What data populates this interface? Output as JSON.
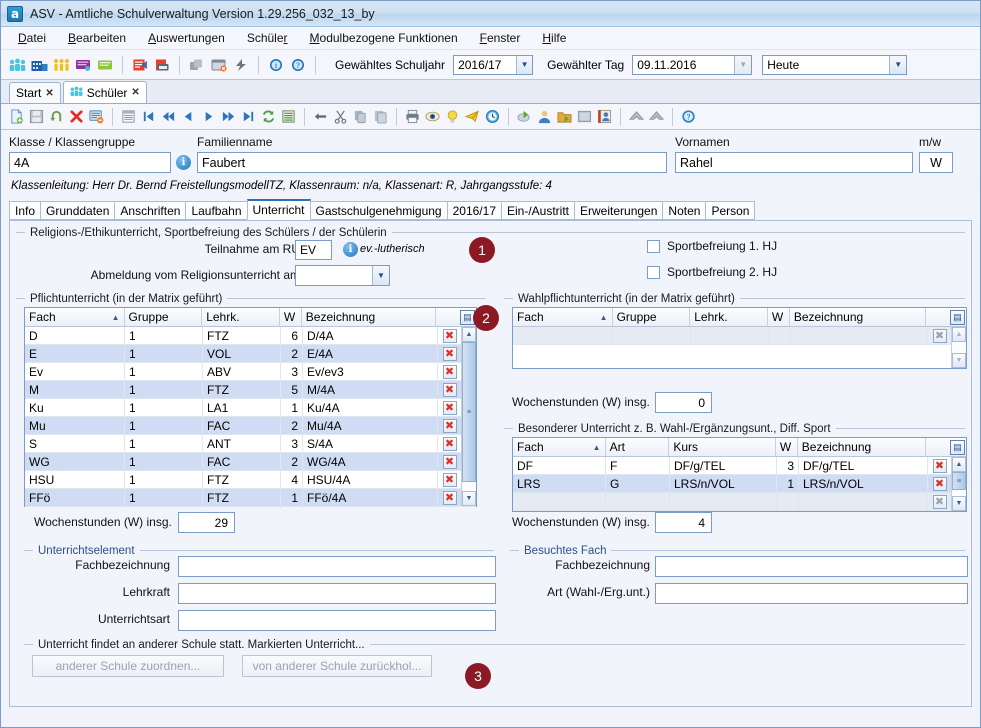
{
  "window": {
    "title": "ASV - Amtliche Schulverwaltung Version 1.29.256_032_13_by",
    "app_icon": "a"
  },
  "menubar": {
    "items": [
      {
        "label": "Datei",
        "mnemonic": "D"
      },
      {
        "label": "Bearbeiten",
        "mnemonic": "B"
      },
      {
        "label": "Auswertungen",
        "mnemonic": "A"
      },
      {
        "label": "Schüler",
        "mnemonic": "r"
      },
      {
        "label": "Modulbezogene Funktionen",
        "mnemonic": "M"
      },
      {
        "label": "Fenster",
        "mnemonic": "F"
      },
      {
        "label": "Hilfe",
        "mnemonic": "H"
      }
    ]
  },
  "main_toolbar": {
    "icons": [
      "students-group-icon",
      "school-building-icon",
      "class-people-icon",
      "notes-violet-icon",
      "notes-green-icon",
      "report-red-icon",
      "print-report-icon",
      "modules-icon",
      "window-close-icon",
      "lightning-icon",
      "info-icon",
      "help-icon"
    ],
    "school_year_label": "Gewähltes Schuljahr",
    "school_year_value": "2016/17",
    "day_label": "Gewählter Tag",
    "day_value": "09.11.2016",
    "day_mode_value": "Heute"
  },
  "doc_tabs": [
    {
      "label": "Start",
      "active": false,
      "icon": ""
    },
    {
      "label": "Schüler",
      "active": true,
      "icon": "students-group-icon"
    }
  ],
  "record_toolbar": {
    "icons": [
      "new-record-icon",
      "save-icon",
      "undo-icon",
      "delete-icon",
      "delete-form-icon",
      "list-icon",
      "first-icon",
      "prev-fast-icon",
      "prev-icon",
      "next-icon",
      "next-fast-icon",
      "last-icon",
      "refresh-icon",
      "report-list-icon",
      "back-arrow-icon",
      "cut-icon",
      "copy-icon",
      "paste-icon",
      "print-icon",
      "preview-icon",
      "idea-icon",
      "send-icon",
      "clock-icon",
      "export-icon",
      "person-icon",
      "folder-export-icon",
      "image-icon",
      "photo-person-icon",
      "up-merge-icon",
      "up-merge2-icon",
      "help-round-icon"
    ]
  },
  "header_form": {
    "klasse_label": "Klasse / Klassengruppe",
    "klasse_value": "4A",
    "familienname_label": "Familienname",
    "familienname_value": "Faubert",
    "vornamen_label": "Vornamen",
    "vornamen_value": "Rahel",
    "mw_label": "m/w",
    "mw_value": "W",
    "class_info": "Klassenleitung: Herr Dr. Bernd FreistellungsmodellTZ, Klassenraum: n/a, Klassenart: R, Jahrgangsstufe: 4"
  },
  "inner_tabs": [
    {
      "label": "Info",
      "active": false
    },
    {
      "label": "Grunddaten",
      "active": false
    },
    {
      "label": "Anschriften",
      "active": false
    },
    {
      "label": "Laufbahn",
      "active": false
    },
    {
      "label": "Unterricht",
      "active": true
    },
    {
      "label": "Gastschulgenehmigung",
      "active": false
    },
    {
      "label": "2016/17",
      "active": false
    },
    {
      "label": "Ein-/Austritt",
      "active": false
    },
    {
      "label": "Erweiterungen",
      "active": false
    },
    {
      "label": "Noten",
      "active": false
    },
    {
      "label": "Person",
      "active": false
    }
  ],
  "religion_section": {
    "title": "Religions-/Ethikunterricht, Sportbefreiung des Schülers / der Schülerin",
    "teilnahme_label": "Teilnahme am RU",
    "teilnahme_value": "EV",
    "teilnahme_note": "ev.-lutherisch",
    "abmeldung_label": "Abmeldung vom Religionsunterricht am",
    "abmeldung_value": "",
    "sport1_label": "Sportbefreiung 1. HJ",
    "sport1_checked": false,
    "sport2_label": "Sportbefreiung 2. HJ",
    "sport2_checked": false
  },
  "pflichtunterricht": {
    "title": "Pflichtunterricht (in der Matrix geführt)",
    "columns": [
      "Fach",
      "Gruppe",
      "Lehrk.",
      "W",
      "Bezeichnung"
    ],
    "sort_column": "Fach",
    "rows": [
      {
        "fach": "D",
        "gruppe": "1",
        "lehrk": "FTZ",
        "w": "6",
        "bez": "D/4A"
      },
      {
        "fach": "E",
        "gruppe": "1",
        "lehrk": "VOL",
        "w": "2",
        "bez": "E/4A"
      },
      {
        "fach": "Ev",
        "gruppe": "1",
        "lehrk": "ABV",
        "w": "3",
        "bez": "Ev/ev3"
      },
      {
        "fach": "M",
        "gruppe": "1",
        "lehrk": "FTZ",
        "w": "5",
        "bez": "M/4A"
      },
      {
        "fach": "Ku",
        "gruppe": "1",
        "lehrk": "LA1",
        "w": "1",
        "bez": "Ku/4A"
      },
      {
        "fach": "Mu",
        "gruppe": "1",
        "lehrk": "FAC",
        "w": "2",
        "bez": "Mu/4A"
      },
      {
        "fach": "S",
        "gruppe": "1",
        "lehrk": "ANT",
        "w": "3",
        "bez": "S/4A"
      },
      {
        "fach": "WG",
        "gruppe": "1",
        "lehrk": "FAC",
        "w": "2",
        "bez": "WG/4A"
      },
      {
        "fach": "HSU",
        "gruppe": "1",
        "lehrk": "FTZ",
        "w": "4",
        "bez": "HSU/4A"
      },
      {
        "fach": "FFö",
        "gruppe": "1",
        "lehrk": "FTZ",
        "w": "1",
        "bez": "FFö/4A"
      }
    ],
    "total_label": "Wochenstunden (W) insg.",
    "total_value": "29"
  },
  "wahlpflichtunterricht": {
    "title": "Wahlpflichtunterricht (in der Matrix geführt)",
    "columns": [
      "Fach",
      "Gruppe",
      "Lehrk.",
      "W",
      "Bezeichnung"
    ],
    "sort_column": "Fach",
    "rows": [],
    "total_label": "Wochenstunden (W) insg.",
    "total_value": "0"
  },
  "besonderer_unterricht": {
    "title": "Besonderer Unterricht z. B. Wahl-/Ergänzungsunt., Diff. Sport",
    "columns": [
      "Fach",
      "Art",
      "Kurs",
      "W",
      "Bezeichnung"
    ],
    "sort_column": "Fach",
    "rows": [
      {
        "fach": "DF",
        "art": "F",
        "kurs": "DF/g/TEL",
        "w": "3",
        "bez": "DF/g/TEL"
      },
      {
        "fach": "LRS",
        "art": "G",
        "kurs": "LRS/n/VOL",
        "w": "1",
        "bez": "LRS/n/VOL"
      }
    ],
    "total_label": "Wochenstunden (W) insg.",
    "total_value": "4"
  },
  "unterrichtselement": {
    "title": "Unterrichtselement",
    "fields": [
      {
        "label": "Fachbezeichnung",
        "value": ""
      },
      {
        "label": "Lehrkraft",
        "value": ""
      },
      {
        "label": "Unterrichtsart",
        "value": ""
      }
    ]
  },
  "besuchtes_fach": {
    "title": "Besuchtes Fach",
    "fields": [
      {
        "label": "Fachbezeichnung",
        "value": ""
      },
      {
        "label": "Art (Wahl-/Erg.unt.)",
        "value": ""
      }
    ]
  },
  "andere_schule": {
    "title": "Unterricht findet an anderer Schule statt. Markierten Unterricht...",
    "btn_zuordnen": "anderer Schule zuordnen...",
    "btn_zurueckholen": "von anderer Schule zurückhol..."
  },
  "badges": [
    {
      "number": "1"
    },
    {
      "number": "2"
    },
    {
      "number": "3"
    }
  ],
  "colors": {
    "badge": "#8b1a25",
    "accent": "#2b4f86",
    "selection": "#cfdcf3",
    "delete": "#d9342b"
  }
}
